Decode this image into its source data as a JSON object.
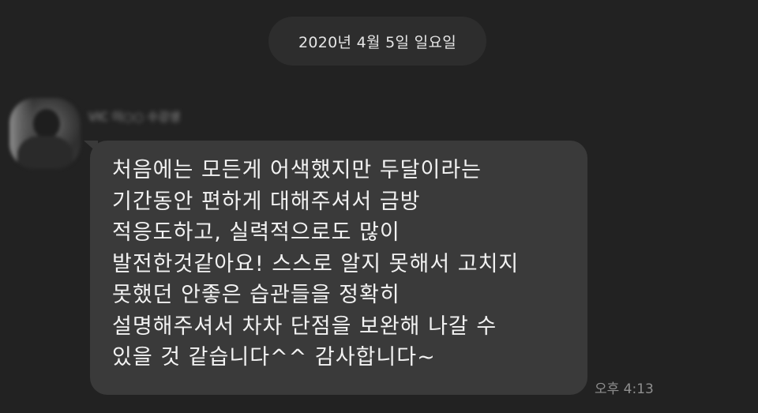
{
  "date_divider": "2020년 4월 5일 일요일",
  "sender": {
    "name": "VIC 이○○ 수강생"
  },
  "message": {
    "lines": [
      "처음에는 모든게 어색했지만 두달이라는",
      "기간동안 편하게 대해주셔서 금방",
      "적응도하고, 실력적으로도 많이",
      "발전한것같아요! 스스로 알지 못해서 고치지",
      "못했던 안좋은 습관들을 정확히",
      "설명해주셔서 차차 단점을 보완해 나갈 수",
      "있을 것 같습니다^^ 감사합니다~"
    ],
    "timestamp": "오후 4:13"
  },
  "colors": {
    "background": "#222222",
    "date_pill": "#2d2d2d",
    "bubble": "#3a3a3a",
    "message_text": "#f2f2f2",
    "timestamp_text": "#8f8f8f"
  }
}
